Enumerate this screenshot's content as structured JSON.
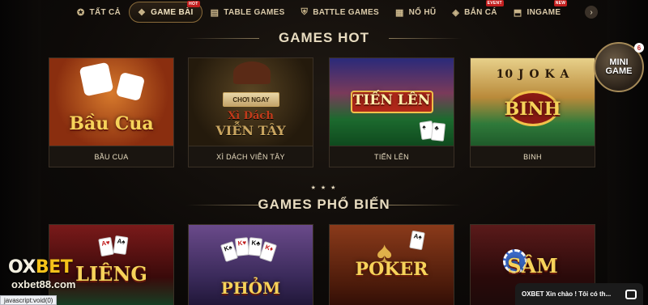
{
  "nav": {
    "items": [
      {
        "label": "TẤT CẢ",
        "icon": "joystick-icon"
      },
      {
        "label": "GAME BÀI",
        "icon": "cards-icon",
        "badge": "HOT",
        "active": true
      },
      {
        "label": "TABLE GAMES",
        "icon": "table-icon"
      },
      {
        "label": "BATTLE GAMES",
        "icon": "shield-icon"
      },
      {
        "label": "NỔ HŨ",
        "icon": "slot-icon"
      },
      {
        "label": "BẮN CÁ",
        "icon": "fish-icon",
        "badge": "EVENT"
      },
      {
        "label": "INGAME",
        "icon": "ingame-icon",
        "badge": "NEW"
      }
    ],
    "next_arrow": "›"
  },
  "sections": {
    "hot_title": "GAMES HOT",
    "popular_title": "GAMES PHỔ BIẾN",
    "stars": "★ ★ ★"
  },
  "hot_games": [
    {
      "label": "BẦU CUA",
      "art_title": "Bầu Cua"
    },
    {
      "label": "XÌ DÁCH VIỄN TÂY",
      "art_title_1": "Xì Dách",
      "art_title_2": "VIỄN TÂY",
      "play_button": "CHƠI NGAY"
    },
    {
      "label": "TIẾN LÊN",
      "art_title": "TIẾN LÊN"
    },
    {
      "label": "BINH",
      "art_title": "BINH",
      "art_top": "10 J O K A"
    }
  ],
  "popular_games": [
    {
      "art_title": "LIÊNG"
    },
    {
      "art_title": "PHỎM"
    },
    {
      "art_title": "POKER"
    },
    {
      "art_title": "SÂM"
    }
  ],
  "mini_game": {
    "line1": "MINI",
    "line2": "GAME",
    "badge": "6"
  },
  "logo": {
    "ox": "OX",
    "bet": "BET",
    "domain": "oxbet88.com"
  },
  "status_bar": "javascript:void(0)",
  "chat": {
    "text": "OXBET Xin chào ! Tôi có th..."
  }
}
